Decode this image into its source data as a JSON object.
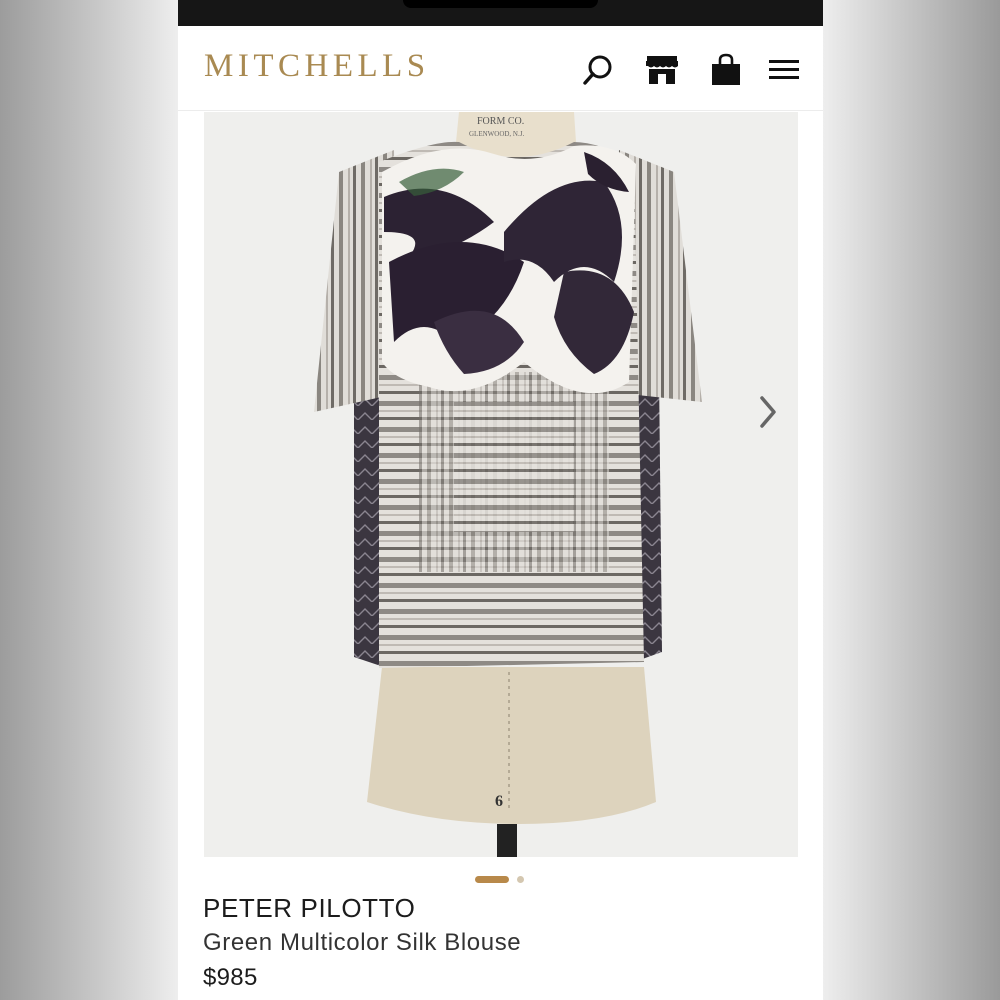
{
  "header": {
    "logo": "MITCHELLS",
    "icons": [
      "search-icon",
      "store-icon",
      "shopping-bag-icon",
      "menu-icon"
    ]
  },
  "product": {
    "brand": "PETER PILOTTO",
    "name": "Green Multicolor Silk Blouse",
    "price": "$985",
    "image_labels": {
      "form_line_1": "FORM CO.",
      "form_line_2": "GLENWOOD, N.J.",
      "form_size": "6"
    }
  },
  "carousel": {
    "active_index": 1,
    "total_images": 2,
    "next_icon": "chevron-right-icon"
  },
  "colors": {
    "brand_gold": "#a98a52",
    "dot_active": "#b8894a",
    "dot_inactive": "#d4c7b0",
    "status_bar": "#161616"
  }
}
